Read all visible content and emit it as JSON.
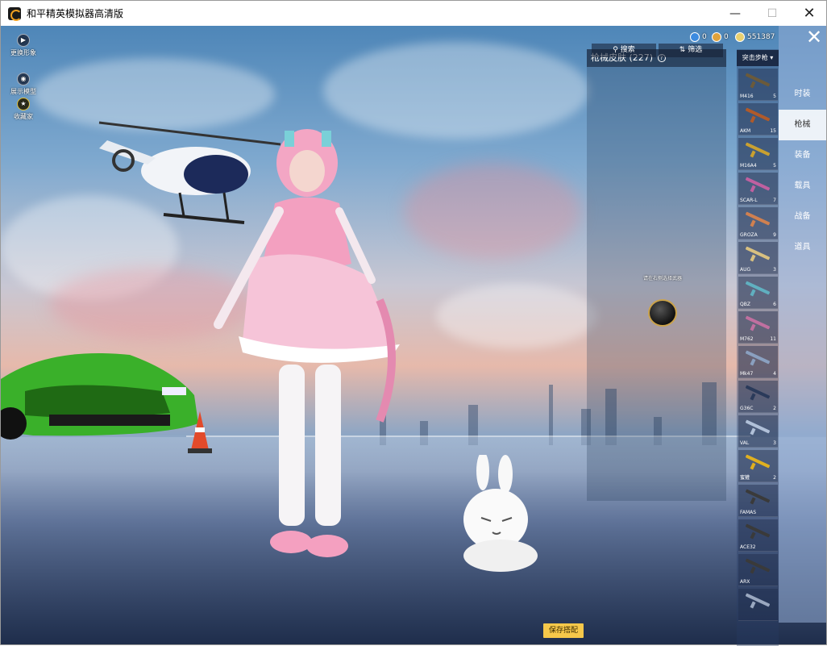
{
  "window": {
    "title": "和平精英模拟器高清版"
  },
  "left_tools": [
    {
      "label": "更换形象",
      "icon": "play-icon"
    },
    {
      "label": "展示模型",
      "icon": "eye-icon"
    },
    {
      "label": "收藏家",
      "icon": "trophy-icon"
    }
  ],
  "currencies": [
    {
      "value": "0",
      "icon": "globe-coin-icon",
      "color": "#3c8be0"
    },
    {
      "value": "0",
      "icon": "gold-coin-icon",
      "color": "#e0a23c"
    },
    {
      "value": "551387",
      "icon": "token-icon",
      "color": "#e8d070"
    }
  ],
  "skin_panel": {
    "title": "枪械皮肤",
    "count": "(227)",
    "search_label": "搜索",
    "filter_label": "筛选",
    "pet_hint": "请在右侧选择武器"
  },
  "weapon_category": "突击步枪",
  "weapons": [
    {
      "name": "M416",
      "count": "5",
      "color": "#6b5a3a"
    },
    {
      "name": "AKM",
      "count": "15",
      "color": "#b05a2a"
    },
    {
      "name": "M16A4",
      "count": "5",
      "color": "#c9a030"
    },
    {
      "name": "SCAR-L",
      "count": "7",
      "color": "#c060a0"
    },
    {
      "name": "GROZA",
      "count": "9",
      "color": "#d08050"
    },
    {
      "name": "AUG",
      "count": "3",
      "color": "#d8c080"
    },
    {
      "name": "QBZ",
      "count": "6",
      "color": "#60b0c0"
    },
    {
      "name": "M762",
      "count": "11",
      "color": "#c070a0"
    },
    {
      "name": "Mk47",
      "count": "4",
      "color": "#8aa0c0"
    },
    {
      "name": "G36C",
      "count": "2",
      "color": "#2a3a5a"
    },
    {
      "name": "VAL",
      "count": "3",
      "color": "#b0c0d8"
    },
    {
      "name": "蜜獾",
      "count": "2",
      "color": "#e0b020"
    },
    {
      "name": "FAMAS",
      "count": "",
      "color": "#3a3a3a"
    },
    {
      "name": "ACE32",
      "count": "",
      "color": "#3a3a3a"
    },
    {
      "name": "ARX",
      "count": "",
      "color": "#3a3a3a"
    },
    {
      "name": "",
      "count": "",
      "color": "#9aa8c0"
    }
  ],
  "categories": [
    {
      "label": "时装",
      "active": false
    },
    {
      "label": "枪械",
      "active": true
    },
    {
      "label": "装备",
      "active": false
    },
    {
      "label": "载具",
      "active": false
    },
    {
      "label": "战备",
      "active": false
    },
    {
      "label": "道具",
      "active": false
    }
  ],
  "save_label": "保存搭配"
}
